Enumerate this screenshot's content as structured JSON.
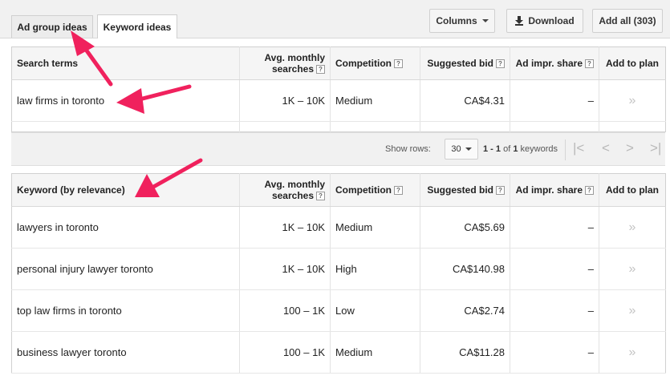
{
  "tabs": {
    "ad_group_ideas": "Ad group ideas",
    "keyword_ideas": "Keyword ideas"
  },
  "toolbar": {
    "columns": "Columns",
    "download": "Download",
    "add_all": "Add all (303)"
  },
  "search_table": {
    "headers": {
      "term": "Search terms",
      "avg": "Avg. monthly searches",
      "competition": "Competition",
      "bid": "Suggested bid",
      "share": "Ad impr. share",
      "add": "Add to plan"
    },
    "rows": [
      {
        "term": "law firms in toronto",
        "avg": "1K – 10K",
        "competition": "Medium",
        "bid": "CA$4.31",
        "share": "–",
        "add": "»"
      }
    ]
  },
  "pager": {
    "show_rows": "Show rows:",
    "rows_value": "30",
    "range": "1 - 1",
    "of": "of",
    "total": "1",
    "unit": "keywords"
  },
  "keyword_table": {
    "headers": {
      "term": "Keyword (by relevance)",
      "avg": "Avg. monthly searches",
      "competition": "Competition",
      "bid": "Suggested bid",
      "share": "Ad impr. share",
      "add": "Add to plan"
    },
    "rows": [
      {
        "term": "lawyers in toronto",
        "avg": "1K – 10K",
        "competition": "Medium",
        "bid": "CA$5.69",
        "share": "–",
        "add": "»"
      },
      {
        "term": "personal injury lawyer toronto",
        "avg": "1K – 10K",
        "competition": "High",
        "bid": "CA$140.98",
        "share": "–",
        "add": "»"
      },
      {
        "term": "top law firms in toronto",
        "avg": "100 – 1K",
        "competition": "Low",
        "bid": "CA$2.74",
        "share": "–",
        "add": "»"
      },
      {
        "term": "business lawyer toronto",
        "avg": "100 – 1K",
        "competition": "Medium",
        "bid": "CA$11.28",
        "share": "–",
        "add": "»"
      }
    ]
  },
  "help_glyph": "?",
  "annotation_color": "#f0215d"
}
